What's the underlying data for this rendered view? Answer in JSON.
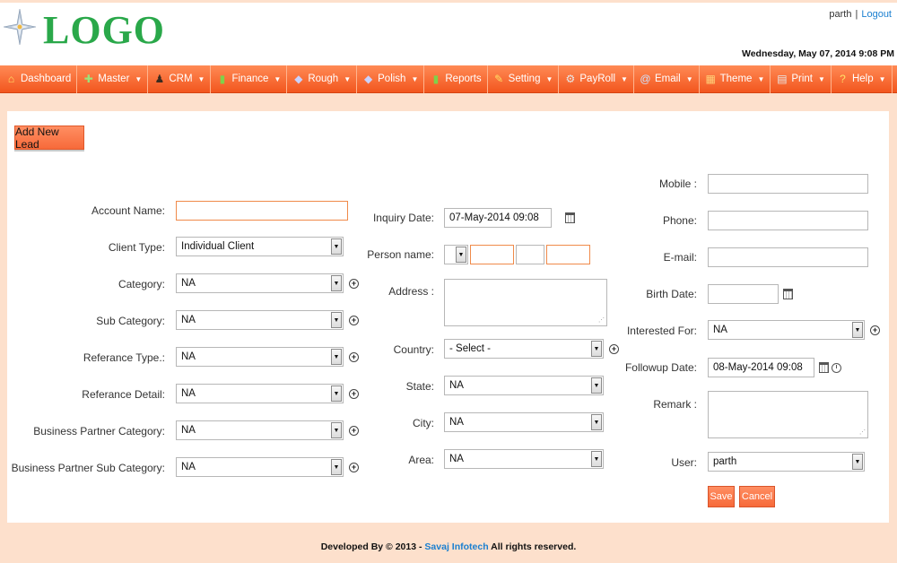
{
  "header": {
    "logo_text": "LOGO",
    "user": "parth",
    "separator": "|",
    "logout_label": "Logout",
    "datetime": "Wednesday, May 07, 2014 9:08 PM"
  },
  "menu": [
    {
      "label": "Dashboard",
      "icon": "home-icon",
      "glyph": "⌂",
      "dropdown": false
    },
    {
      "label": "Master",
      "icon": "plus-icon",
      "glyph": "✚",
      "dropdown": true
    },
    {
      "label": "CRM",
      "icon": "person-icon",
      "glyph": "♟",
      "dropdown": true
    },
    {
      "label": "Finance",
      "icon": "bar-chart-icon",
      "glyph": "▮",
      "dropdown": true
    },
    {
      "label": "Rough",
      "icon": "diamond-icon",
      "glyph": "◆",
      "dropdown": true
    },
    {
      "label": "Polish",
      "icon": "diamond-icon",
      "glyph": "◆",
      "dropdown": true
    },
    {
      "label": "Reports",
      "icon": "bar-chart-icon",
      "glyph": "▮",
      "dropdown": false
    },
    {
      "label": "Setting",
      "icon": "wrench-icon",
      "glyph": "✎",
      "dropdown": true
    },
    {
      "label": "PayRoll",
      "icon": "gear-icon",
      "glyph": "⚙",
      "dropdown": true
    },
    {
      "label": "Email",
      "icon": "at-icon",
      "glyph": "@",
      "dropdown": true
    },
    {
      "label": "Theme",
      "icon": "palette-icon",
      "glyph": "▦",
      "dropdown": true
    },
    {
      "label": "Print",
      "icon": "printer-icon",
      "glyph": "▤",
      "dropdown": true
    },
    {
      "label": "Help",
      "icon": "question-icon",
      "glyph": "?",
      "dropdown": true
    }
  ],
  "form": {
    "add_new_lead_label": "Add New Lead",
    "account_name": {
      "label": "Account Name:",
      "value": ""
    },
    "client_type": {
      "label": "Client Type:",
      "value": "Individual Client"
    },
    "category": {
      "label": "Category:",
      "value": "NA"
    },
    "sub_category": {
      "label": "Sub Category:",
      "value": "NA"
    },
    "referance_type": {
      "label": "Referance Type.:",
      "value": "NA"
    },
    "referance_detail": {
      "label": "Referance Detail:",
      "value": "NA"
    },
    "bp_category": {
      "label": "Business Partner Category:",
      "value": "NA"
    },
    "bp_sub_category": {
      "label": "Business Partner Sub Category:",
      "value": "NA"
    },
    "inquiry_date": {
      "label": "Inquiry Date:",
      "value": "07-May-2014 09:08"
    },
    "person_name": {
      "label": "Person name:",
      "title": "",
      "first": "",
      "middle": "",
      "last": ""
    },
    "address": {
      "label": "Address :",
      "value": ""
    },
    "country": {
      "label": "Country:",
      "value": "- Select -"
    },
    "state": {
      "label": "State:",
      "value": "NA"
    },
    "city": {
      "label": "City:",
      "value": "NA"
    },
    "area": {
      "label": "Area:",
      "value": "NA"
    },
    "mobile": {
      "label": "Mobile :",
      "value": ""
    },
    "phone": {
      "label": "Phone:",
      "value": ""
    },
    "email": {
      "label": "E-mail:",
      "value": ""
    },
    "birth_date": {
      "label": "Birth Date:",
      "value": ""
    },
    "interested_for": {
      "label": "Interested For:",
      "value": "NA"
    },
    "followup_date": {
      "label": "Followup Date:",
      "value": "08-May-2014 09:08"
    },
    "remark": {
      "label": "Remark :",
      "value": ""
    },
    "user": {
      "label": "User:",
      "value": "parth"
    },
    "save_label": "Save",
    "cancel_label": "Cancel"
  },
  "footer": {
    "prefix": "Developed By © 2013 -",
    "company": "Savaj Infotech",
    "suffix": "All rights reserved."
  },
  "colors": {
    "menu_bar": "#f2561e",
    "accent_orange": "#f76a3a",
    "page_bg": "#fde0cc",
    "logo_green": "#2aa84a",
    "link_blue": "#1a7fd0"
  }
}
